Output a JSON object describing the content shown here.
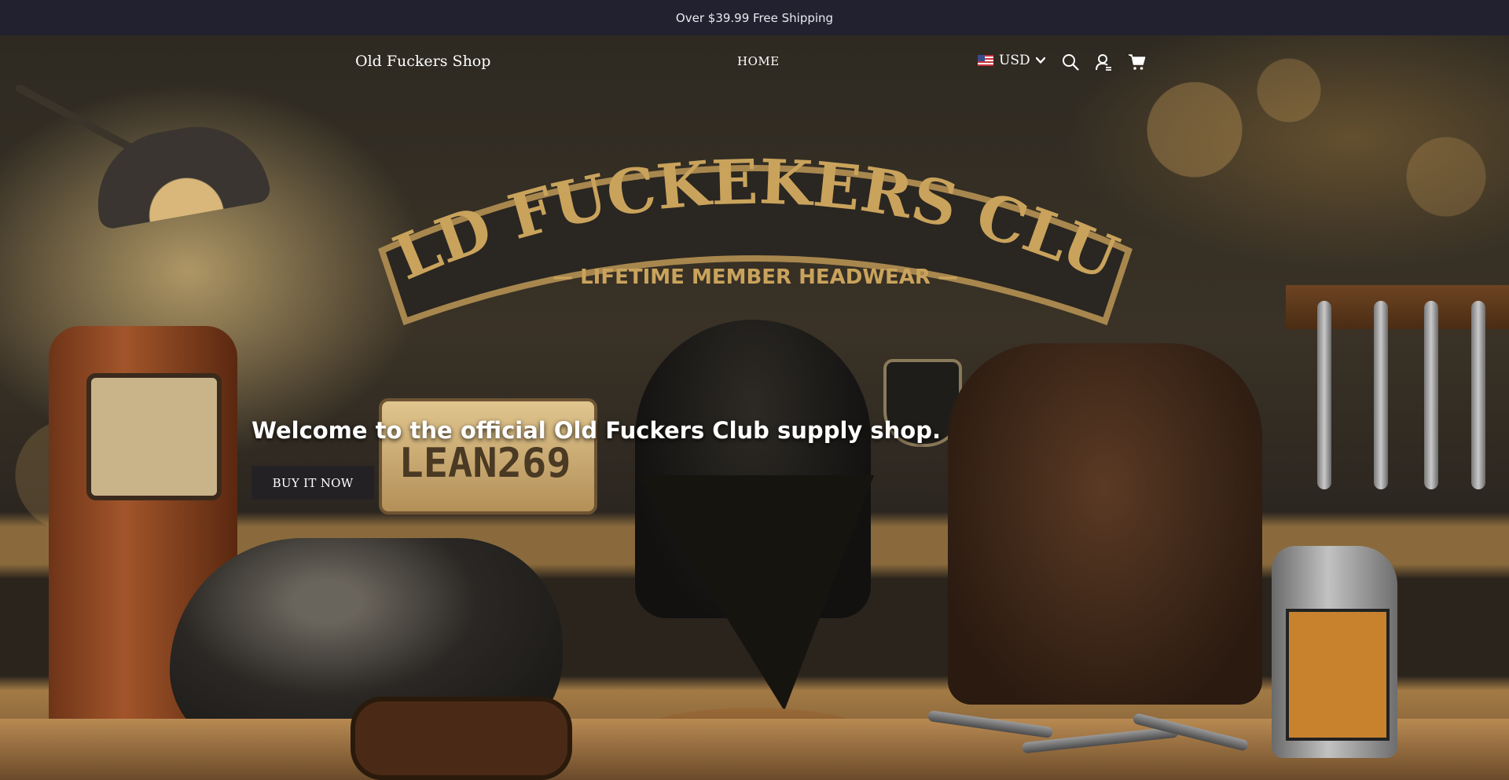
{
  "announcement": {
    "text": "Over $39.99 Free Shipping"
  },
  "header": {
    "logo": "Old Fuckers Shop",
    "nav": {
      "home": "HOME"
    },
    "currency": {
      "flag_icon": "us-flag-icon",
      "code": "USD",
      "chevron_icon": "chevron-down-icon"
    },
    "icons": {
      "search": "search-icon",
      "account": "account-icon",
      "cart": "cart-icon"
    }
  },
  "hero": {
    "sign_title": "OLD FUCKEKERS CLUB",
    "sign_subtitle": "— LIFETIME MEMBER HEADWEAR —",
    "plate_text": "LEAN269",
    "heading": "Welcome to the official Old Fuckers Club supply shop.",
    "button": "BUY IT NOW"
  },
  "colors": {
    "announcement_bg": "#22212f",
    "button_bg": "#232124",
    "text": "#ffffff",
    "accent_gold": "#c9a35c"
  }
}
